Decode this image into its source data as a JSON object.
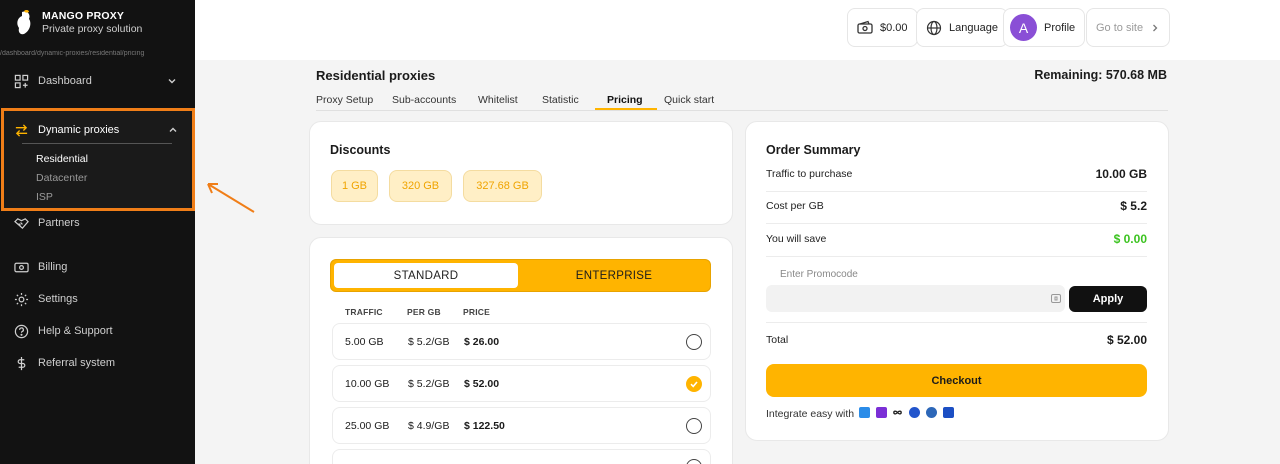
{
  "brand": {
    "name": "MANGO PROXY",
    "tagline": "Private proxy solution"
  },
  "url_hint": "/dashboard/dynamic-proxies/residential/pricing",
  "sidebar": {
    "items": [
      {
        "label": "Dashboard",
        "icon": "grid-icon"
      },
      {
        "label": "Dynamic proxies",
        "icon": "swap-arrows-icon"
      },
      {
        "label": "Partners",
        "icon": "handshake-icon"
      },
      {
        "label": "Billing",
        "icon": "money-icon"
      },
      {
        "label": "Settings",
        "icon": "gear-icon"
      },
      {
        "label": "Help & Support",
        "icon": "help-circle-icon"
      },
      {
        "label": "Referral system",
        "icon": "dollar-icon"
      }
    ],
    "dynamic_sub": [
      "Residential",
      "Datacenter",
      "ISP"
    ],
    "active_sub": "Residential",
    "highlight_color": "#f07e18"
  },
  "topbar": {
    "balance": "$0.00",
    "language": "Language",
    "avatar_letter": "A",
    "profile": "Profile",
    "go_to_site": "Go to site"
  },
  "header": {
    "title": "Residential proxies",
    "remaining": "Remaining: 570.68 MB",
    "tabs": [
      "Proxy Setup",
      "Sub-accounts",
      "Whitelist",
      "Statistic",
      "Pricing",
      "Quick start"
    ],
    "active_tab": "Pricing"
  },
  "discounts": {
    "title": "Discounts",
    "chips": [
      "1 GB",
      "320 GB",
      "327.68 GB"
    ]
  },
  "plans": {
    "toggle": {
      "standard": "STANDARD",
      "enterprise": "ENTERPRISE",
      "selected": "STANDARD"
    },
    "columns": [
      "TRAFFIC",
      "PER GB",
      "PRICE"
    ],
    "rows": [
      {
        "traffic": "5.00 GB",
        "per_gb": "$ 5.2/GB",
        "price": "$ 26.00",
        "selected": false
      },
      {
        "traffic": "10.00 GB",
        "per_gb": "$ 5.2/GB",
        "price": "$ 52.00",
        "selected": true
      },
      {
        "traffic": "25.00 GB",
        "per_gb": "$ 4.9/GB",
        "price": "$ 122.50",
        "selected": false
      }
    ]
  },
  "summary": {
    "title": "Order Summary",
    "traffic_label": "Traffic to purchase",
    "traffic_value": "10.00 GB",
    "cost_label": "Cost per GB",
    "cost_value": "$ 5.2",
    "save_label": "You will save",
    "save_value": "$ 0.00",
    "promo_label": "Enter Promocode",
    "promo_value": "",
    "apply": "Apply",
    "total_label": "Total",
    "total_value": "$ 52.00",
    "checkout": "Checkout",
    "integrate": "Integrate easy with",
    "integrations": [
      "integration-a-icon",
      "integration-b-icon",
      "infinity-icon",
      "integration-c-icon",
      "integration-d-icon",
      "integration-e-icon"
    ]
  },
  "colors": {
    "accent": "#ffb400",
    "success": "#3cc320",
    "sidebar_bg": "#121212"
  }
}
